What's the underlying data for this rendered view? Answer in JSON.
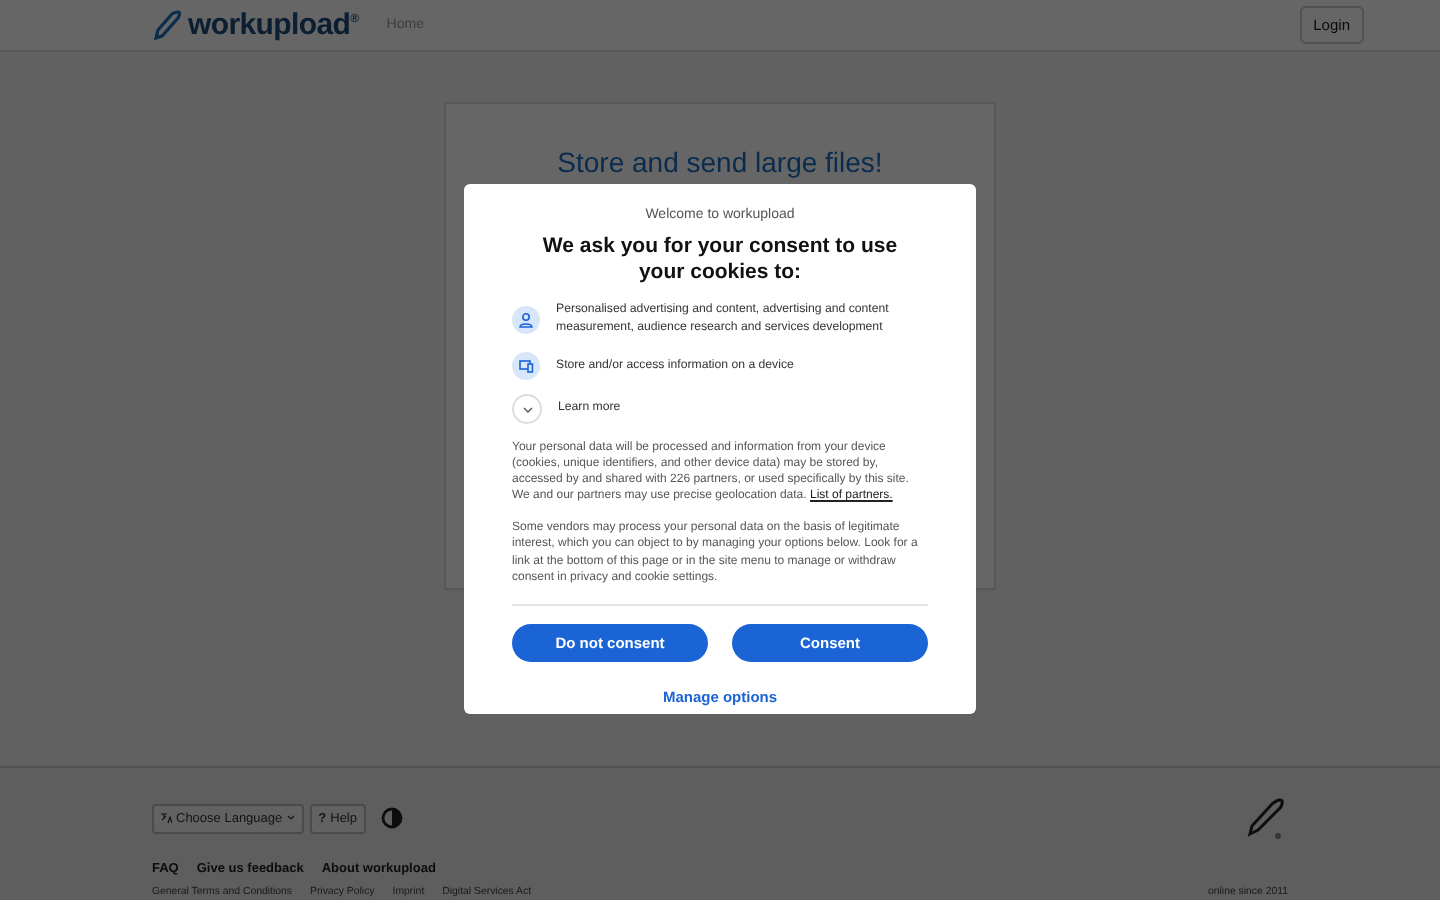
{
  "header": {
    "logo": "workupload",
    "logo_mark": "®",
    "nav": [
      "Home"
    ],
    "login": "Login"
  },
  "card": {
    "title": "Store and send large files!"
  },
  "consent": {
    "subtitle": "Welcome to workupload",
    "heading": "We ask you for your consent to use your cookies to:",
    "purposes": [
      {
        "kind": "person",
        "text": "Personalised advertising and content, advertising and content measurement, audience research and services development"
      },
      {
        "kind": "device",
        "text": "Store and/or access information on a device"
      }
    ],
    "learn_more": "Learn more",
    "paragraph_1": "Your personal data will be processed and information from your device (cookies, unique identifiers, and other device data) may be stored by, accessed by and shared with 226 partners, or used specifically by this site. We and our partners may use precise geolocation data.",
    "partners_link": "List of partners.",
    "paragraph_2": "Some vendors may process your personal data on the basis of legitimate interest, which you can object to by managing your options below. Look for a link at the bottom of this page or in the site menu to manage or withdraw consent in privacy and cookie settings.",
    "buttons": [
      "Do not consent",
      "Consent"
    ],
    "manage": "Manage options"
  },
  "footer": {
    "language": "Choose Language",
    "help_mark": "?",
    "help": "Help",
    "links": [
      "FAQ",
      "Give us feedback",
      "About workupload"
    ],
    "legal": [
      "General Terms and Conditions",
      "Privacy Policy",
      "Imprint",
      "Digital Services Act"
    ],
    "since": "online since 2011"
  }
}
